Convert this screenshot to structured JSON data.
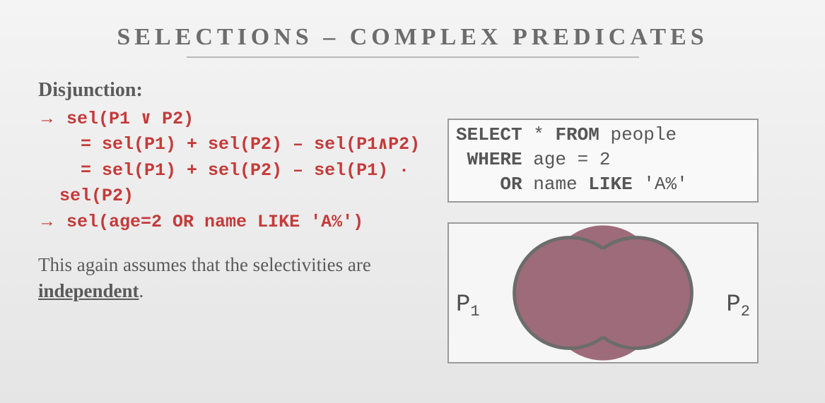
{
  "title": "SELECTIONS – COMPLEX PREDICATES",
  "subhead": "Disjunction:",
  "formula": {
    "arrow": "→",
    "line1": "sel(P1 ∨ P2)",
    "line2": "    = sel(P1) + sel(P2) – sel(P1∧P2)",
    "line3": "    = sel(P1) + sel(P2) – sel(P1) ∙",
    "line3b": "  sel(P2)",
    "line4": "sel(age=2 OR name LIKE 'A%')"
  },
  "paragraph": {
    "prefix": "This again assumes that the selectivities are ",
    "underlined": "independent",
    "suffix": "."
  },
  "sql": {
    "select": "SELECT",
    "star": " * ",
    "from": "FROM",
    "table": " people",
    "where_indent": " ",
    "where": "WHERE",
    "cond1": " age = 2",
    "or_indent": "    ",
    "or": "OR",
    "cond2a": " name ",
    "like": "LIKE",
    "cond2b": " 'A%'"
  },
  "venn": {
    "p1": "P",
    "p1sub": "1",
    "p2": "P",
    "p2sub": "2"
  }
}
